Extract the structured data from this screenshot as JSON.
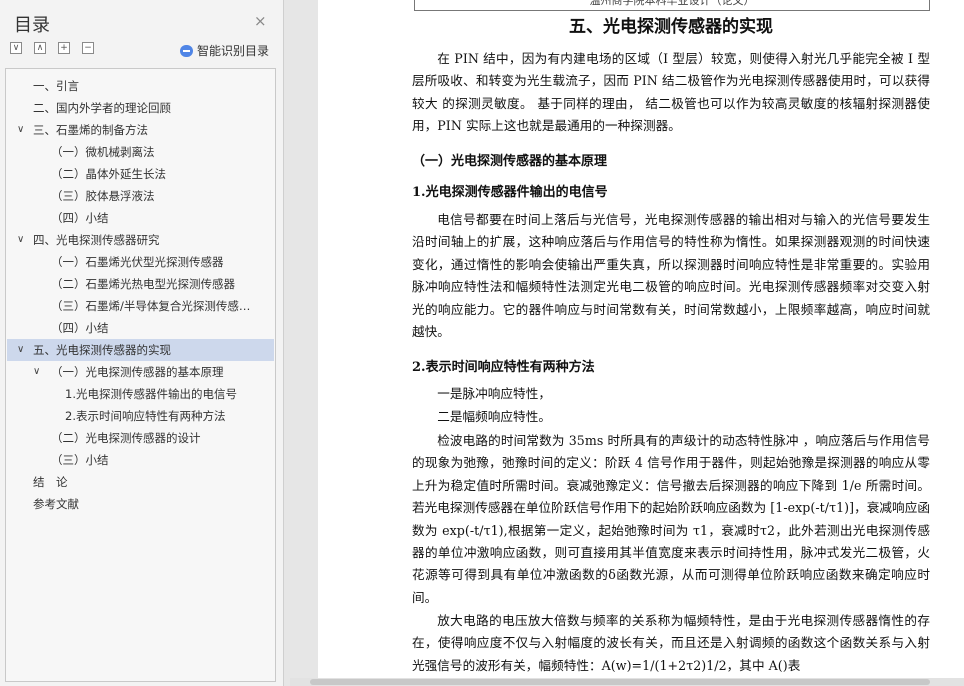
{
  "nav": {
    "title": "目录",
    "close_glyph": "×",
    "toolbar": [
      "∨",
      "∧",
      "+",
      "−"
    ],
    "smart_label": "智能识别目录",
    "items": [
      {
        "label": "一、引言",
        "indent": 0,
        "caret": ""
      },
      {
        "label": "二、国内外学者的理论回顾",
        "indent": 0,
        "caret": ""
      },
      {
        "label": "三、石墨烯的制备方法",
        "indent": 0,
        "caret": "∨"
      },
      {
        "label": "（一）微机械剥离法",
        "indent": 1,
        "caret": ""
      },
      {
        "label": "（二）晶体外延生长法",
        "indent": 1,
        "caret": ""
      },
      {
        "label": "（三）胶体悬浮液法",
        "indent": 1,
        "caret": ""
      },
      {
        "label": "（四）小结",
        "indent": 1,
        "caret": ""
      },
      {
        "label": "四、光电探测传感器研究",
        "indent": 0,
        "caret": "∨"
      },
      {
        "label": "（一）石墨烯光伏型光探测传感器",
        "indent": 1,
        "caret": ""
      },
      {
        "label": "（二）石墨烯光热电型光探测传感器",
        "indent": 1,
        "caret": ""
      },
      {
        "label": "（三）石墨烯/半导体复合光探测传感…",
        "indent": 1,
        "caret": ""
      },
      {
        "label": "（四）小结",
        "indent": 1,
        "caret": ""
      },
      {
        "label": "五、光电探测传感器的实现",
        "indent": 0,
        "caret": "∨",
        "selected": true
      },
      {
        "label": "（一）光电探测传感器的基本原理",
        "indent": 1,
        "caret": "∨"
      },
      {
        "label": "1.光电探测传感器件输出的电信号",
        "indent": 2,
        "caret": ""
      },
      {
        "label": "2.表示时间响应特性有两种方法",
        "indent": 2,
        "caret": ""
      },
      {
        "label": "（二）光电探测传感器的设计",
        "indent": 1,
        "caret": ""
      },
      {
        "label": "（三）小结",
        "indent": 1,
        "caret": ""
      },
      {
        "label": "结　论",
        "indent": -1,
        "caret": ""
      },
      {
        "label": "参考文献",
        "indent": -1,
        "caret": ""
      }
    ]
  },
  "doc": {
    "header": "温州商学院本科毕业设计（论文）",
    "title": "五、光电探测传感器的实现",
    "p1": "在 PIN 结中，因为有内建电场的区域（I 型层）较宽，则使得入射光几乎能完全被 I 型 层所吸收、和转变为光生载流子，因而 PIN 结二极管作为光电探测传感器使用时，可以获得较大 的探测灵敏度。 基于同样的理由， 结二极管也可以作为较高灵敏度的核辐射探测器使用，PIN 实际上这也就是最通用的一种探测器。",
    "h1": "（一）光电探测传感器的基本原理",
    "h2": "1.光电探测传感器件输出的电信号",
    "p2": "电信号都要在时间上落后与光信号，光电探测传感器的输出相对与输入的光信号要发生沿时间轴上的扩展，这种响应落后与作用信号的特性称为惰性。如果探测器观测的时间快速变化，通过惰性的影响会使输出严重失真，所以探测器时间响应特性是非常重要的。实验用脉冲响应特性法和幅频特性法测定光电二极管的响应时间。光电探测传感器频率对交变入射光的响应能力。它的器件响应与时间常数有关，时间常数越小，上限频率越高，响应时间就越快。",
    "h3": "2.表示时间响应特性有两种方法",
    "p3a": "一是脉冲响应特性，",
    "p3b": "二是幅频响应特性。",
    "p4": "检波电路的时间常数为 35ms 时所具有的声级计的动态特性脉冲 ，响应落后与作用信号的现象为弛豫，弛豫时间的定义：阶跃 4 信号作用于器件，则起始弛豫是探测器的响应从零上升为稳定值时所需时间。衰减弛豫定义：信号撤去后探测器的响应下降到 1/e 所需时间。若光电探测传感器在单位阶跃信号作用下的起始阶跃响应函数为 [1-exp(-t/τ1)]，衰减响应函数为 exp(-t/τ1),根据第一定义，起始弛豫时间为 τ1，衰减时τ2，此外若测出光电探测传感器的单位冲激响应函数，则可直接用其半值宽度来表示时间持性用，脉冲式发光二极管，火花源等可得到具有单位冲激函数的δ函数光源，从而可测得单位阶跃响应函数来确定响应时间。",
    "p5": "放大电路的电压放大倍数与频率的关系称为幅频特性，是由于光电探测传感器惰性的存在，使得响应度不仅与入射幅度的波长有关，而且还是入射调频的函数这个函数关系与入射光强信号的波形有关，幅频特性：A(w)=1/(1+2τ2)1/2，其中 A()表"
  }
}
